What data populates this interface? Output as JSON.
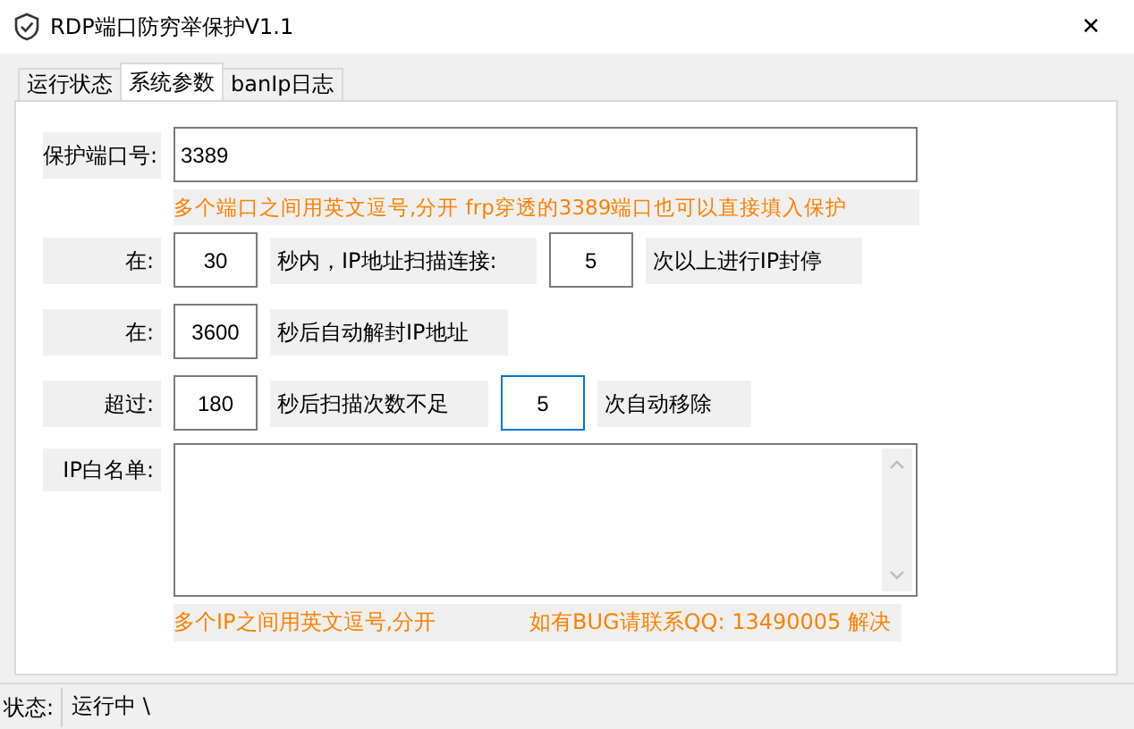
{
  "window": {
    "title": "RDP端口防穷举保护V1.1",
    "close": "✕"
  },
  "tabs": [
    {
      "label": "运行状态",
      "selected": false
    },
    {
      "label": "系统参数",
      "selected": true
    },
    {
      "label": "banIp日志",
      "selected": false
    }
  ],
  "port": {
    "label": "保护端口号:",
    "value": "3389",
    "hint": "多个端口之间用英文逗号,分开  frp穿透的3389端口也可以直接填入保护"
  },
  "rules": [
    {
      "label": "在:",
      "parts": [
        {
          "kind": "input",
          "value": "30",
          "focused": false
        },
        {
          "kind": "text",
          "text": "秒内，IP地址扫描连接:"
        },
        {
          "kind": "input",
          "value": "5",
          "focused": false
        },
        {
          "kind": "text",
          "text": "次以上进行IP封停"
        }
      ]
    },
    {
      "label": "在:",
      "parts": [
        {
          "kind": "input",
          "value": "3600",
          "focused": false
        },
        {
          "kind": "text",
          "text": "秒后自动解封IP地址"
        }
      ]
    },
    {
      "label": "超过:",
      "parts": [
        {
          "kind": "input",
          "value": "180",
          "focused": false
        },
        {
          "kind": "text",
          "text": "秒后扫描次数不足"
        },
        {
          "kind": "input",
          "value": "5",
          "focused": true
        },
        {
          "kind": "text",
          "text": "次自动移除"
        }
      ]
    }
  ],
  "whitelist": {
    "label": "IP白名单:",
    "hint": "多个IP之间用英文逗号,分开",
    "contact": "如有BUG请联系QQ: 13490005 解决"
  },
  "status_bar": {
    "label": "状态:",
    "value": "运行中 \\"
  }
}
